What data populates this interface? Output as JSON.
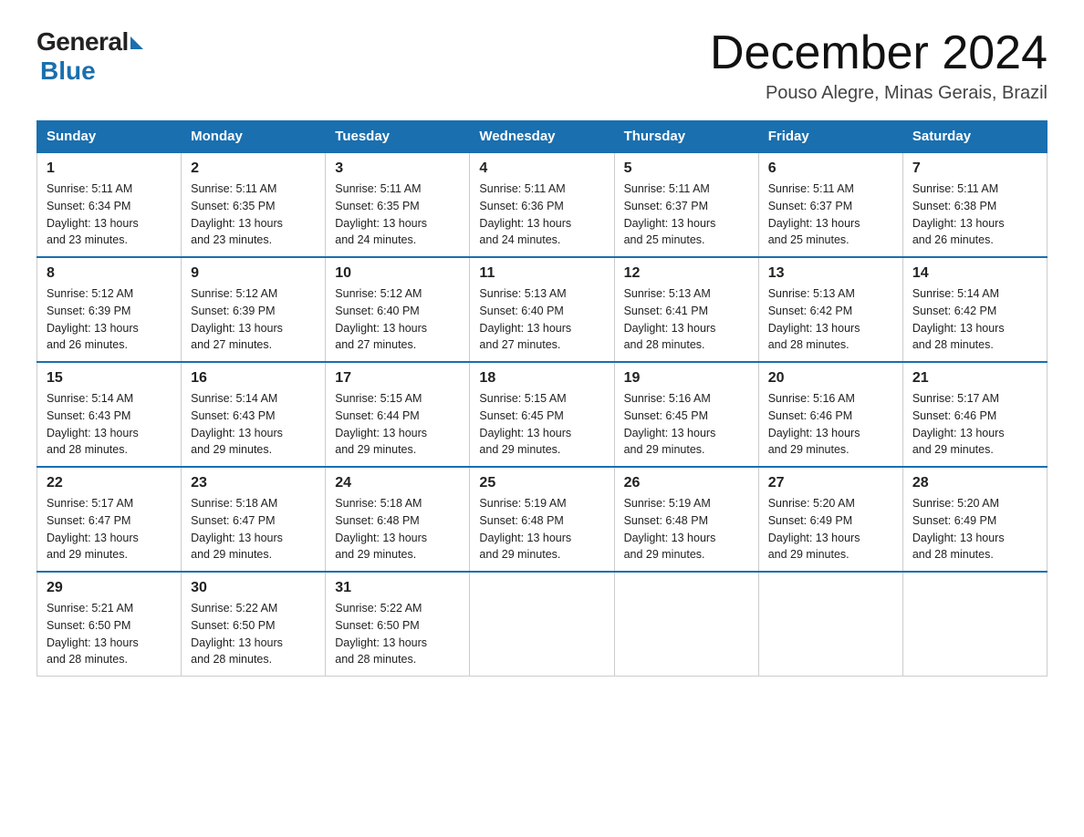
{
  "header": {
    "logo_general": "General",
    "logo_blue": "Blue",
    "month": "December 2024",
    "location": "Pouso Alegre, Minas Gerais, Brazil"
  },
  "weekdays": [
    "Sunday",
    "Monday",
    "Tuesday",
    "Wednesday",
    "Thursday",
    "Friday",
    "Saturday"
  ],
  "weeks": [
    [
      {
        "day": "1",
        "sunrise": "5:11 AM",
        "sunset": "6:34 PM",
        "daylight": "13 hours and 23 minutes."
      },
      {
        "day": "2",
        "sunrise": "5:11 AM",
        "sunset": "6:35 PM",
        "daylight": "13 hours and 23 minutes."
      },
      {
        "day": "3",
        "sunrise": "5:11 AM",
        "sunset": "6:35 PM",
        "daylight": "13 hours and 24 minutes."
      },
      {
        "day": "4",
        "sunrise": "5:11 AM",
        "sunset": "6:36 PM",
        "daylight": "13 hours and 24 minutes."
      },
      {
        "day": "5",
        "sunrise": "5:11 AM",
        "sunset": "6:37 PM",
        "daylight": "13 hours and 25 minutes."
      },
      {
        "day": "6",
        "sunrise": "5:11 AM",
        "sunset": "6:37 PM",
        "daylight": "13 hours and 25 minutes."
      },
      {
        "day": "7",
        "sunrise": "5:11 AM",
        "sunset": "6:38 PM",
        "daylight": "13 hours and 26 minutes."
      }
    ],
    [
      {
        "day": "8",
        "sunrise": "5:12 AM",
        "sunset": "6:39 PM",
        "daylight": "13 hours and 26 minutes."
      },
      {
        "day": "9",
        "sunrise": "5:12 AM",
        "sunset": "6:39 PM",
        "daylight": "13 hours and 27 minutes."
      },
      {
        "day": "10",
        "sunrise": "5:12 AM",
        "sunset": "6:40 PM",
        "daylight": "13 hours and 27 minutes."
      },
      {
        "day": "11",
        "sunrise": "5:13 AM",
        "sunset": "6:40 PM",
        "daylight": "13 hours and 27 minutes."
      },
      {
        "day": "12",
        "sunrise": "5:13 AM",
        "sunset": "6:41 PM",
        "daylight": "13 hours and 28 minutes."
      },
      {
        "day": "13",
        "sunrise": "5:13 AM",
        "sunset": "6:42 PM",
        "daylight": "13 hours and 28 minutes."
      },
      {
        "day": "14",
        "sunrise": "5:14 AM",
        "sunset": "6:42 PM",
        "daylight": "13 hours and 28 minutes."
      }
    ],
    [
      {
        "day": "15",
        "sunrise": "5:14 AM",
        "sunset": "6:43 PM",
        "daylight": "13 hours and 28 minutes."
      },
      {
        "day": "16",
        "sunrise": "5:14 AM",
        "sunset": "6:43 PM",
        "daylight": "13 hours and 29 minutes."
      },
      {
        "day": "17",
        "sunrise": "5:15 AM",
        "sunset": "6:44 PM",
        "daylight": "13 hours and 29 minutes."
      },
      {
        "day": "18",
        "sunrise": "5:15 AM",
        "sunset": "6:45 PM",
        "daylight": "13 hours and 29 minutes."
      },
      {
        "day": "19",
        "sunrise": "5:16 AM",
        "sunset": "6:45 PM",
        "daylight": "13 hours and 29 minutes."
      },
      {
        "day": "20",
        "sunrise": "5:16 AM",
        "sunset": "6:46 PM",
        "daylight": "13 hours and 29 minutes."
      },
      {
        "day": "21",
        "sunrise": "5:17 AM",
        "sunset": "6:46 PM",
        "daylight": "13 hours and 29 minutes."
      }
    ],
    [
      {
        "day": "22",
        "sunrise": "5:17 AM",
        "sunset": "6:47 PM",
        "daylight": "13 hours and 29 minutes."
      },
      {
        "day": "23",
        "sunrise": "5:18 AM",
        "sunset": "6:47 PM",
        "daylight": "13 hours and 29 minutes."
      },
      {
        "day": "24",
        "sunrise": "5:18 AM",
        "sunset": "6:48 PM",
        "daylight": "13 hours and 29 minutes."
      },
      {
        "day": "25",
        "sunrise": "5:19 AM",
        "sunset": "6:48 PM",
        "daylight": "13 hours and 29 minutes."
      },
      {
        "day": "26",
        "sunrise": "5:19 AM",
        "sunset": "6:48 PM",
        "daylight": "13 hours and 29 minutes."
      },
      {
        "day": "27",
        "sunrise": "5:20 AM",
        "sunset": "6:49 PM",
        "daylight": "13 hours and 29 minutes."
      },
      {
        "day": "28",
        "sunrise": "5:20 AM",
        "sunset": "6:49 PM",
        "daylight": "13 hours and 28 minutes."
      }
    ],
    [
      {
        "day": "29",
        "sunrise": "5:21 AM",
        "sunset": "6:50 PM",
        "daylight": "13 hours and 28 minutes."
      },
      {
        "day": "30",
        "sunrise": "5:22 AM",
        "sunset": "6:50 PM",
        "daylight": "13 hours and 28 minutes."
      },
      {
        "day": "31",
        "sunrise": "5:22 AM",
        "sunset": "6:50 PM",
        "daylight": "13 hours and 28 minutes."
      },
      null,
      null,
      null,
      null
    ]
  ],
  "labels": {
    "sunrise": "Sunrise:",
    "sunset": "Sunset:",
    "daylight": "Daylight:"
  }
}
